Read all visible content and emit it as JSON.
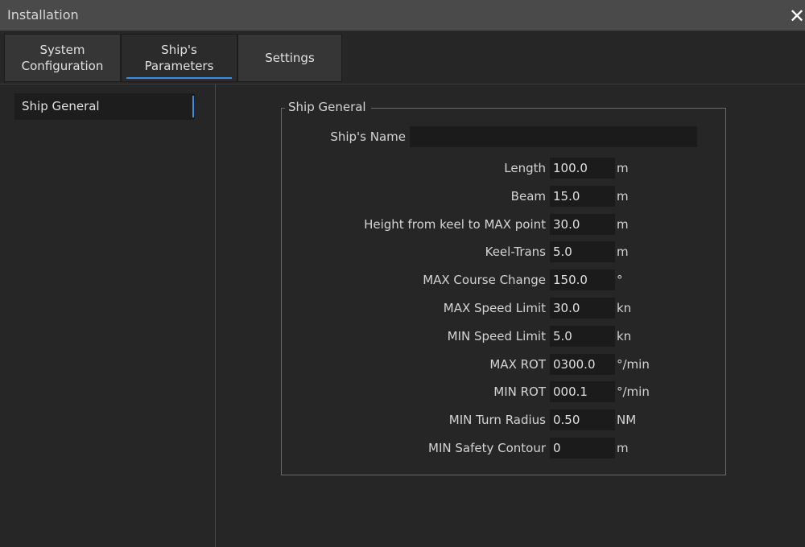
{
  "window": {
    "title": "Installation"
  },
  "tabs": [
    {
      "line1": "System",
      "line2": "Configuration"
    },
    {
      "line1": "Ship's",
      "line2": "Parameters"
    },
    {
      "line1": "Settings",
      "line2": ""
    }
  ],
  "sidebar": {
    "items": [
      {
        "label": "Ship General"
      }
    ]
  },
  "group": {
    "legend": "Ship General",
    "ship_name": {
      "label": "Ship's Name",
      "value": ""
    },
    "rows": [
      {
        "label": "Length",
        "value": "100.0",
        "unit": "m"
      },
      {
        "label": "Beam",
        "value": "15.0",
        "unit": "m"
      },
      {
        "label": "Height from keel to MAX point",
        "value": "30.0",
        "unit": "m"
      },
      {
        "label": "Keel-Trans",
        "value": "5.0",
        "unit": "m"
      },
      {
        "label": "MAX Course Change",
        "value": "150.0",
        "unit": "°"
      },
      {
        "label": "MAX Speed Limit",
        "value": "30.0",
        "unit": "kn"
      },
      {
        "label": "MIN Speed Limit",
        "value": "5.0",
        "unit": "kn"
      },
      {
        "label": "MAX ROT",
        "value": "0300.0",
        "unit": "°/min"
      },
      {
        "label": "MIN ROT",
        "value": "000.1",
        "unit": "°/min"
      },
      {
        "label": "MIN Turn Radius",
        "value": "0.50",
        "unit": "NM"
      },
      {
        "label": "MIN Safety Contour",
        "value": "0",
        "unit": "m"
      }
    ]
  }
}
